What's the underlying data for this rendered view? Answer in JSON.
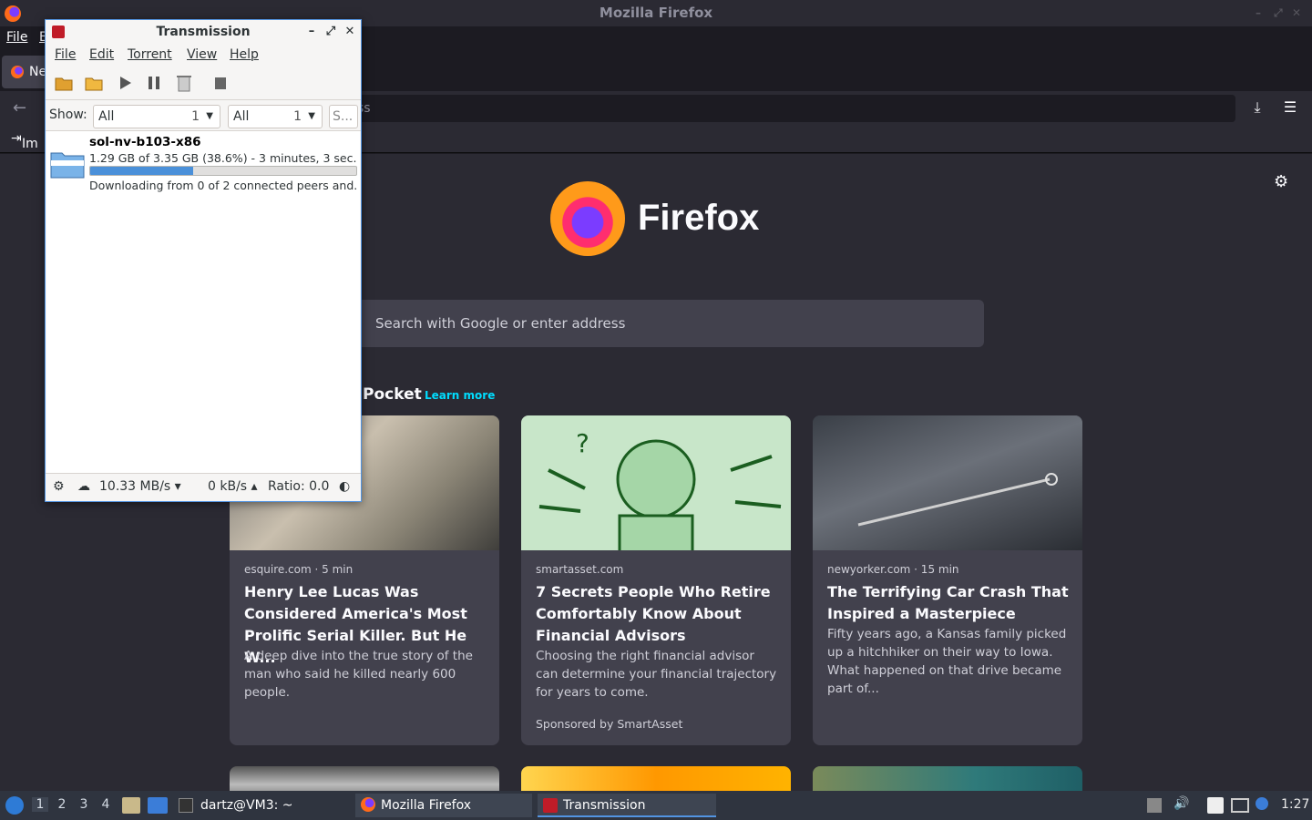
{
  "firefox": {
    "window_title": "Mozilla Firefox",
    "menu_file": "File",
    "menu_edit_partial": "E",
    "tab_label": "Ne",
    "url_partial": "ss",
    "bookmark_partial": "Im",
    "wordmark": "Firefox",
    "search_placeholder": "Search with Google or enter address",
    "pocket_heading": "Pocket",
    "pocket_learn_more": "Learn more",
    "cards": [
      {
        "source": "esquire.com · 5 min",
        "title": "Henry Lee Lucas Was Considered America's Most Prolific Serial Killer. But He W...",
        "excerpt": "A deep dive into the true story of the man who said he killed nearly 600 people."
      },
      {
        "source": "smartasset.com",
        "title": "7 Secrets People Who Retire Comfortably Know About Financial Advisors",
        "excerpt": "Choosing the right financial advisor can determine your financial trajectory for years to come.",
        "sponsor": "Sponsored by SmartAsset"
      },
      {
        "source": "newyorker.com · 15 min",
        "title": "The Terrifying Car Crash That Inspired a Masterpiece",
        "excerpt": "Fifty years ago, a Kansas family picked up a hitchhiker on their way to Iowa. What happened on that drive became part of..."
      }
    ]
  },
  "transmission": {
    "title": "Transmission",
    "menus": [
      "File",
      "Edit",
      "Torrent",
      "View",
      "Help"
    ],
    "show_label": "Show:",
    "filter1": {
      "value": "All",
      "count": "1"
    },
    "filter2": {
      "value": "All",
      "count": "1"
    },
    "search_placeholder": "S...",
    "torrent": {
      "name": "sol-nv-b103-x86",
      "progress_text": "1.29 GB of 3.35 GB (38.6%) - 3 minutes, 3 sec...",
      "progress_fraction": 0.386,
      "status": "Downloading from 0 of 2 connected peers and..."
    },
    "down_speed": "10.33 MB/s ▾",
    "up_speed": "0 kB/s ▴",
    "ratio": "Ratio: 0.0"
  },
  "taskbar": {
    "workspaces": [
      "1",
      "2",
      "3",
      "4"
    ],
    "tasks": [
      "dartz@VM3: ~",
      "Mozilla Firefox",
      "Transmission"
    ],
    "clock": "1:27"
  }
}
